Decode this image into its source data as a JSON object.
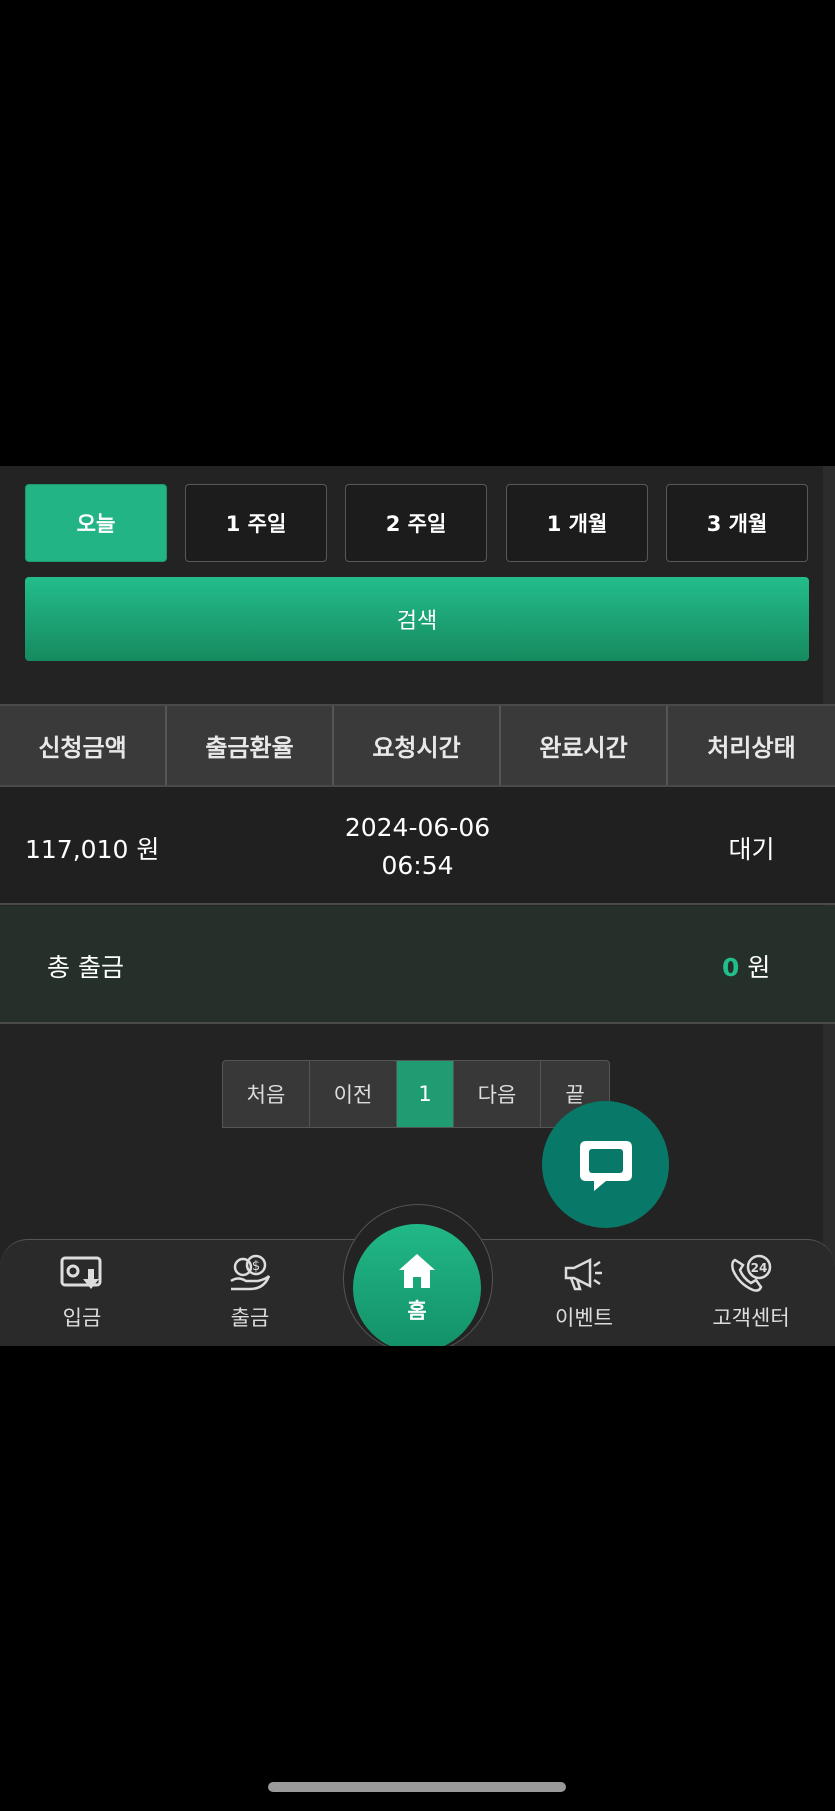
{
  "periods": [
    {
      "label": "오늘",
      "active": true
    },
    {
      "label": "1 주일",
      "active": false
    },
    {
      "label": "2 주일",
      "active": false
    },
    {
      "label": "1 개월",
      "active": false
    },
    {
      "label": "3 개월",
      "active": false
    }
  ],
  "search_label": "검색",
  "table": {
    "headers": [
      "신청금액",
      "출금환율",
      "요청시간",
      "완료시간",
      "처리상태"
    ],
    "rows": [
      {
        "amount": "117,010 원",
        "rate": "",
        "request_date": "2024-06-06",
        "request_time": "06:54",
        "complete": "",
        "status": "대기"
      }
    ]
  },
  "total": {
    "label": "총 출금",
    "value": "0",
    "unit": "원"
  },
  "pagination": {
    "first": "처음",
    "prev": "이전",
    "current": "1",
    "next": "다음",
    "last": "끝"
  },
  "nav": {
    "deposit": "입금",
    "withdraw": "출금",
    "home": "홈",
    "event": "이벤트",
    "support": "고객센터"
  },
  "colors": {
    "accent": "#23bd8c",
    "chat": "#087868"
  }
}
